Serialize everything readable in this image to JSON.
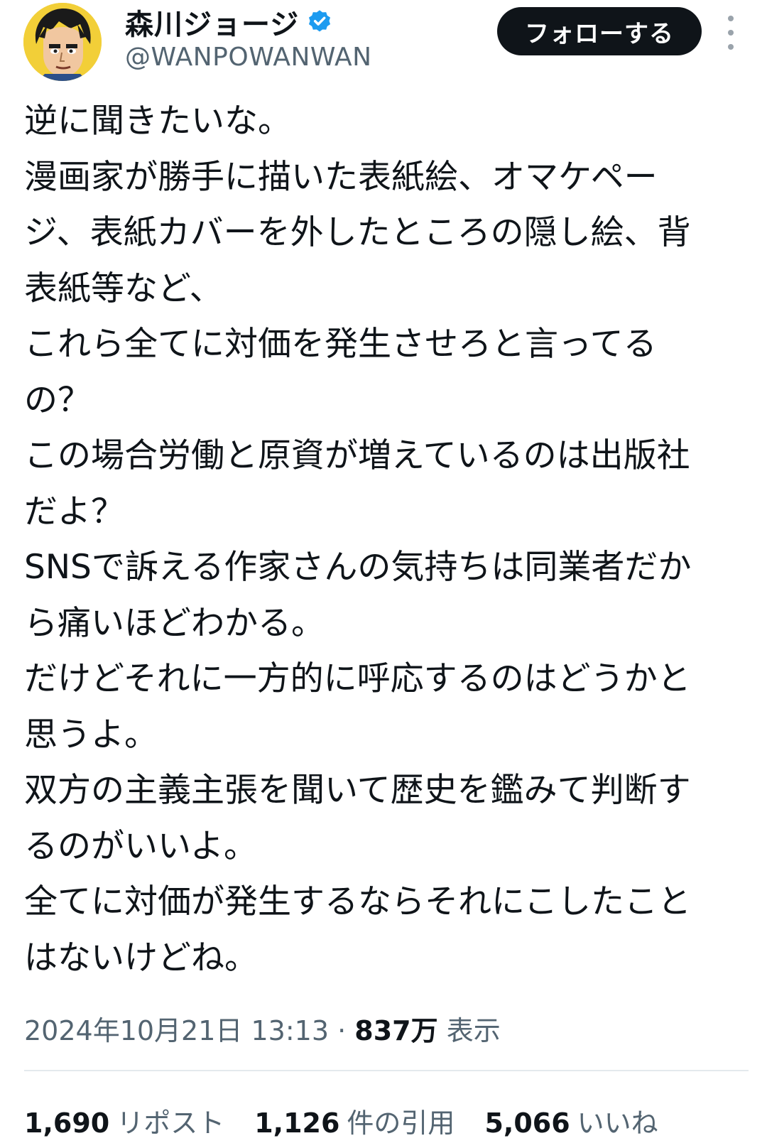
{
  "user": {
    "display_name": "森川ジョージ",
    "handle": "@WANPOWANWAN",
    "verified": true,
    "verified_color": "#1d9bf0"
  },
  "follow_button_label": "フォローする",
  "tweet": {
    "lines": [
      "逆に聞きたいな。",
      "漫画家が勝手に描いた表紙絵、オマケペー",
      "ジ、表紙カバーを外したところの隠し絵、背",
      "表紙等など、",
      "これら全てに対価を発生させろと言ってる",
      "の？",
      "この場合労働と原資が増えているのは出版社",
      "だよ？",
      "SNSで訴える作家さんの気持ちは同業者だか",
      "ら痛いほどわかる。",
      "だけどそれに一方的に呼応するのはどうかと",
      "思うよ。",
      "双方の主義主張を聞いて歴史を鑑みて判断す",
      "るのがいいよ。",
      "全てに対価が発生するならそれにこしたこと",
      "はないけどね。"
    ]
  },
  "meta": {
    "timestamp": "2024年10月21日 13:13",
    "separator": "·",
    "views_count": "837万",
    "views_label": "表示"
  },
  "stats": [
    {
      "count": "1,690",
      "label": "リポスト"
    },
    {
      "count": "1,126",
      "label": "件の引用"
    },
    {
      "count": "5,066",
      "label": "いいね"
    }
  ],
  "colors": {
    "text_primary": "#0f1419",
    "text_secondary": "#536471",
    "button_bg": "#0f1419",
    "divider": "#e4e9ed"
  },
  "icons": [
    "avatar",
    "verified-badge-icon",
    "more-options-icon"
  ]
}
